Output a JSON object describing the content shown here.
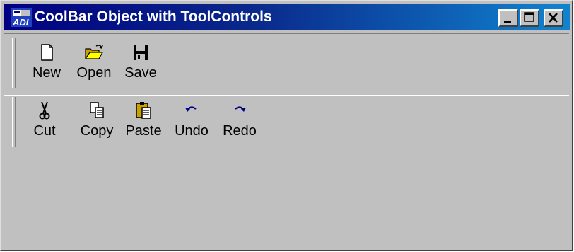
{
  "window": {
    "title": "CoolBar Object with ToolControls"
  },
  "bands": [
    {
      "tools": [
        {
          "label": "New",
          "icon": "new-file-icon"
        },
        {
          "label": "Open",
          "icon": "open-folder-icon"
        },
        {
          "label": "Save",
          "icon": "save-disk-icon"
        }
      ]
    },
    {
      "tools": [
        {
          "label": "Cut",
          "icon": "cut-scissors-icon"
        },
        {
          "label": "Copy",
          "icon": "copy-icon"
        },
        {
          "label": "Paste",
          "icon": "paste-clipboard-icon"
        },
        {
          "label": "Undo",
          "icon": "undo-icon"
        },
        {
          "label": "Redo",
          "icon": "redo-icon"
        }
      ]
    }
  ],
  "colors": {
    "titlebar_start": "#000080",
    "titlebar_end": "#1084d0",
    "face": "#c0c0c0"
  }
}
